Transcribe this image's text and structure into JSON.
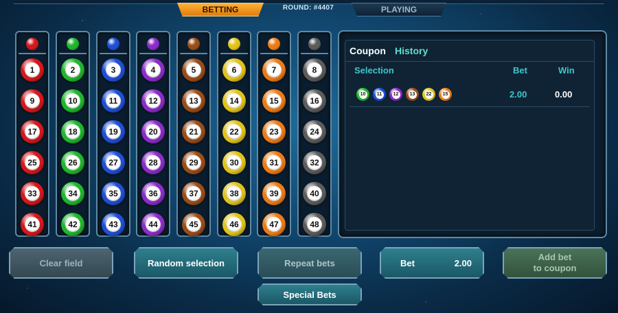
{
  "top": {
    "betting_tab": "BETTING",
    "round_label": "ROUND: #4407",
    "playing_tab": "PLAYING"
  },
  "colors": {
    "red": "#d4181c",
    "green": "#1fb52c",
    "blue": "#1f4fd6",
    "purple": "#8c2cc8",
    "brown": "#9a4d18",
    "yellow": "#e0c21a",
    "orange": "#ec7b16",
    "gray": "#5c5c5c"
  },
  "columns": [
    {
      "color": "red",
      "balls": [
        "1",
        "9",
        "17",
        "25",
        "33",
        "41"
      ]
    },
    {
      "color": "green",
      "balls": [
        "2",
        "10",
        "18",
        "26",
        "34",
        "42"
      ]
    },
    {
      "color": "blue",
      "balls": [
        "3",
        "11",
        "19",
        "27",
        "35",
        "43"
      ]
    },
    {
      "color": "purple",
      "balls": [
        "4",
        "12",
        "20",
        "28",
        "36",
        "44"
      ]
    },
    {
      "color": "brown",
      "balls": [
        "5",
        "13",
        "21",
        "29",
        "37",
        "45"
      ]
    },
    {
      "color": "yellow",
      "balls": [
        "6",
        "14",
        "22",
        "30",
        "38",
        "46"
      ]
    },
    {
      "color": "orange",
      "balls": [
        "7",
        "15",
        "23",
        "31",
        "39",
        "47"
      ]
    },
    {
      "color": "gray",
      "balls": [
        "8",
        "16",
        "24",
        "32",
        "40",
        "48"
      ]
    }
  ],
  "coupon": {
    "tab_coupon": "Coupon",
    "tab_history": "History",
    "col_selection": "Selection",
    "col_bet": "Bet",
    "col_win": "Win",
    "selection": [
      {
        "num": "10",
        "color": "green"
      },
      {
        "num": "11",
        "color": "blue"
      },
      {
        "num": "12",
        "color": "purple"
      },
      {
        "num": "13",
        "color": "brown"
      },
      {
        "num": "22",
        "color": "yellow"
      },
      {
        "num": "15",
        "color": "orange"
      }
    ],
    "bet": "2.00",
    "win": "0.00"
  },
  "buttons": {
    "clear_field": "Clear field",
    "random_selection": "Random selection",
    "repeat_bets": "Repeat bets",
    "bet_label": "Bet",
    "bet_value": "2.00",
    "add_bet_line1": "Add bet",
    "add_bet_line2": "to coupon",
    "special_bets": "Special Bets"
  }
}
